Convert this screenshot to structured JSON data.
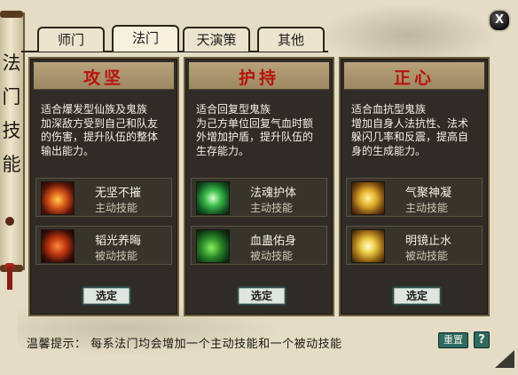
{
  "scroll": {
    "title": [
      "法",
      "门",
      "技",
      "能"
    ]
  },
  "tabs": [
    {
      "label": "师门",
      "active": false
    },
    {
      "label": "法门",
      "active": true
    },
    {
      "label": "天演策",
      "active": false
    },
    {
      "label": "其他",
      "active": false
    }
  ],
  "close": {
    "label": "X"
  },
  "panels": [
    {
      "title": "攻坚",
      "desc": [
        "适合爆发型仙族及鬼族",
        "加深敌方受到自己和队友",
        "的伤害，提升队伍的整体",
        "输出能力。"
      ],
      "skills": [
        {
          "name": "无坚不摧",
          "type": "主动技能",
          "icon": "flame-warrior-icon"
        },
        {
          "name": "韬光养晦",
          "type": "被动技能",
          "icon": "fire-burst-icon"
        }
      ],
      "select": "选定"
    },
    {
      "title": "护持",
      "desc": [
        "适合回复型鬼族",
        "为己方单位回复气血时额",
        "外增加护盾，提升队伍的",
        "生存能力。"
      ],
      "skills": [
        {
          "name": "法魂护体",
          "type": "主动技能",
          "icon": "green-aura-icon"
        },
        {
          "name": "血蛊佑身",
          "type": "被动技能",
          "icon": "green-claw-icon"
        }
      ],
      "select": "选定"
    },
    {
      "title": "正心",
      "desc": [
        "适合血抗型鬼族",
        "增加自身人法抗性、法术",
        "躲闪几率和反震，提高自",
        "身的生成能力。"
      ],
      "skills": [
        {
          "name": "气聚神凝",
          "type": "主动技能",
          "icon": "golden-meditation-icon"
        },
        {
          "name": "明镜止水",
          "type": "被动技能",
          "icon": "golden-light-icon"
        }
      ],
      "select": "选定"
    }
  ],
  "footer": {
    "tip": "温馨提示：  每系法门均会增加一个主动技能和一个被动技能",
    "reset": "重置",
    "help": "?"
  },
  "colors": {
    "title_red": "#b8130a",
    "panel_bg": "#2f2c28",
    "button_teal": "#2f6a62"
  }
}
